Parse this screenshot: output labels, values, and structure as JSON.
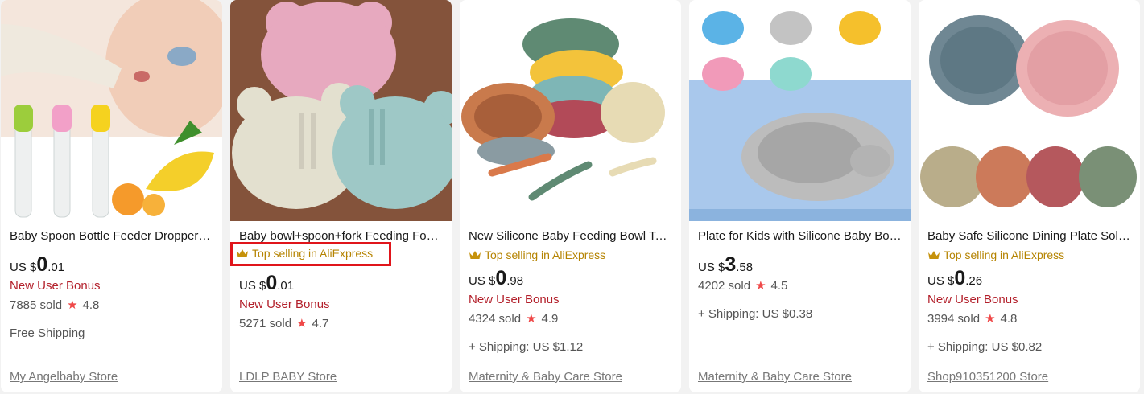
{
  "products": [
    {
      "title": "Baby Spoon Bottle Feeder Dropper Silicone Spoons for Feeding Medicine Kids Toddler Cutlery Utensils",
      "badge": "",
      "currency": "US $",
      "price_int": "0",
      "price_dec": ".01",
      "bonus": "New User Bonus",
      "sold": "7885 sold",
      "rating": "4.8",
      "shipping": "Free Shipping",
      "store": "My Angelbaby Store"
    },
    {
      "title": "Baby bowl+spoon+fork Feeding Food Tableware Cartoon Bear",
      "badge": "Top selling in AliExpress",
      "currency": "US $",
      "price_int": "0",
      "price_dec": ".01",
      "bonus": "New User Bonus",
      "sold": "5271 sold",
      "rating": "4.7",
      "shipping": "",
      "store": "LDLP BABY Store"
    },
    {
      "title": "New Silicone Baby Feeding Bowl Tableware for Kids Waterproof Suction",
      "badge": "Top selling in AliExpress",
      "currency": "US $",
      "price_int": "0",
      "price_dec": ".98",
      "bonus": "New User Bonus",
      "sold": "4324 sold",
      "rating": "4.9",
      "shipping": "+ Shipping: US $1.12",
      "store": "Maternity & Baby Care Store"
    },
    {
      "title": "Plate for Kids with Silicone Baby Bowl Suction",
      "badge": "",
      "currency": "US $",
      "price_int": "3",
      "price_dec": ".58",
      "bonus": "",
      "sold": "4202 sold",
      "rating": "4.5",
      "shipping": "+ Shipping: US $0.38",
      "store": "Maternity & Baby Care Store"
    },
    {
      "title": "Baby Safe Silicone Dining Plate Solid Cute Cartoon",
      "badge": "Top selling in AliExpress",
      "currency": "US $",
      "price_int": "0",
      "price_dec": ".26",
      "bonus": "New User Bonus",
      "sold": "3994 sold",
      "rating": "4.8",
      "shipping": "+ Shipping: US $0.82",
      "store": "Shop910351200 Store"
    }
  ],
  "icons": {
    "badge": "crown-icon",
    "rating": "star-icon"
  },
  "colors": {
    "bonus": "#b3202b",
    "badge": "#b58300",
    "star": "#ef4848",
    "highlight": "#e0151b"
  }
}
